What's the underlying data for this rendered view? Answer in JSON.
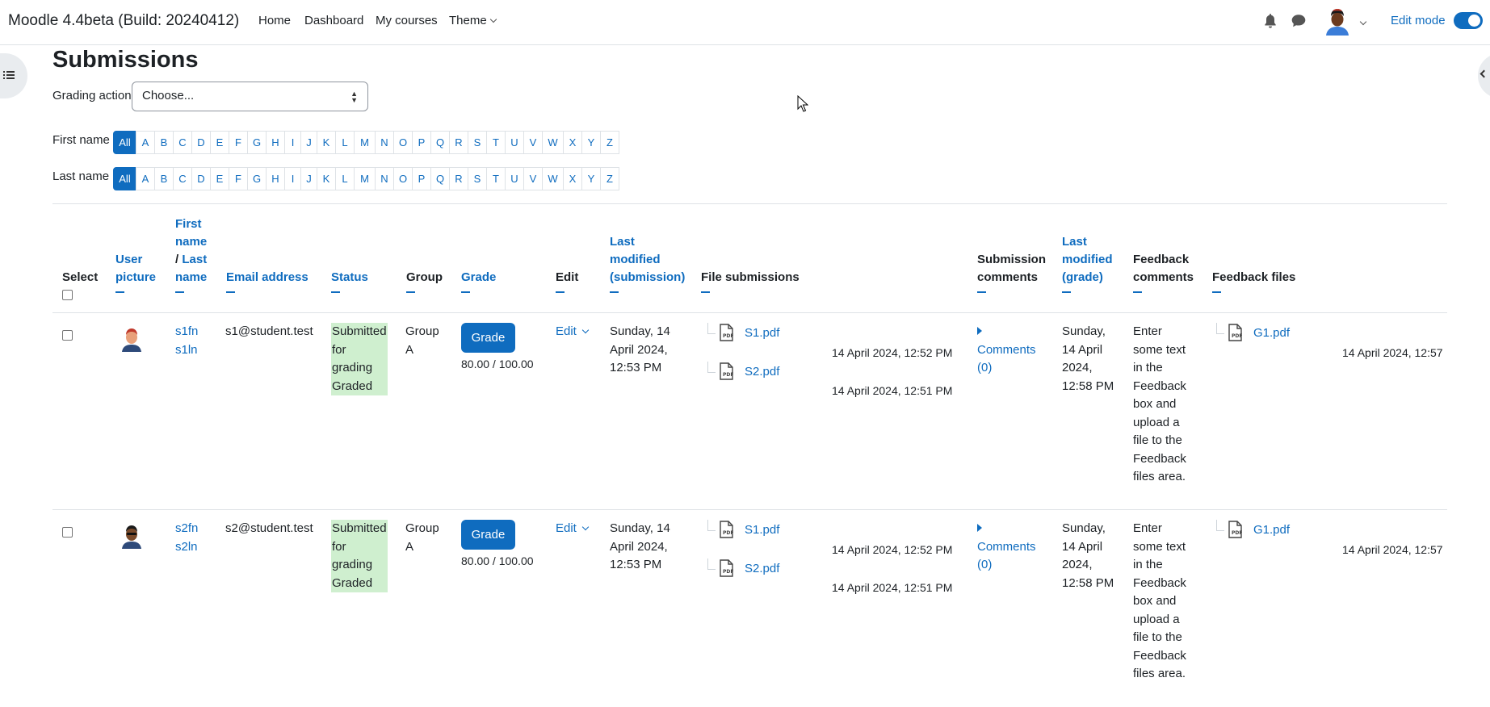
{
  "site": {
    "name": "Moodle 4.4beta (Build: 20240412)",
    "nav": [
      "Home",
      "Dashboard",
      "My courses",
      "Theme"
    ],
    "edit_mode_label": "Edit mode",
    "edit_mode_on": true
  },
  "page": {
    "title": "Submissions",
    "grading_action_label": "Grading action",
    "grading_action_value": "Choose..."
  },
  "initials": {
    "first_name_label": "First name",
    "last_name_label": "Last name",
    "letters": [
      "All",
      "A",
      "B",
      "C",
      "D",
      "E",
      "F",
      "G",
      "H",
      "I",
      "J",
      "K",
      "L",
      "M",
      "N",
      "O",
      "P",
      "Q",
      "R",
      "S",
      "T",
      "U",
      "V",
      "W",
      "X",
      "Y",
      "Z"
    ],
    "selected_first": "All",
    "selected_last": "All"
  },
  "table": {
    "headers": {
      "select": "Select",
      "user_picture": [
        "User",
        "picture"
      ],
      "name": [
        "First",
        "name",
        "/ ",
        "Last",
        "name"
      ],
      "email": "Email address",
      "status": "Status",
      "group": "Group",
      "grade": "Grade",
      "edit": "Edit",
      "last_modified_submission": [
        "Last",
        "modified",
        "(submission)"
      ],
      "file_submissions": "File submissions",
      "submission_comments": [
        "Submission",
        "comments"
      ],
      "last_modified_grade": [
        "Last",
        "modified",
        "(grade)"
      ],
      "feedback_comments": [
        "Feedback",
        "comments"
      ],
      "feedback_files": "Feedback files"
    },
    "rows": [
      {
        "first_name": "s1fn",
        "last_name": "s1ln",
        "email": "s1@student.test",
        "status": [
          "Submitted",
          "for",
          "grading",
          "Graded"
        ],
        "group": [
          "Group",
          "A"
        ],
        "grade_button": "Grade",
        "grade_value": "80.00 / 100.00",
        "edit": "Edit",
        "last_modified_submission": [
          "Sunday, 14",
          "April 2024,",
          "12:53 PM"
        ],
        "files": [
          {
            "name": "S1.pdf",
            "time": "14 April 2024, 12:52 PM"
          },
          {
            "name": "S2.pdf",
            "time": "14 April 2024, 12:51 PM"
          }
        ],
        "comments_label": [
          "Comments",
          "(0)"
        ],
        "last_modified_grade": [
          "Sunday,",
          "14 April",
          "2024,",
          "12:58 PM"
        ],
        "feedback_comments": [
          "Enter",
          "some text",
          "in the",
          "Feedback",
          "box and",
          "upload a",
          "file to the",
          "Feedback",
          "files area."
        ],
        "feedback_file": {
          "name": "G1.pdf",
          "time": "14 April 2024, 12:57"
        },
        "avatar_color": "#e8a07a"
      },
      {
        "first_name": "s2fn",
        "last_name": "s2ln",
        "email": "s2@student.test",
        "status": [
          "Submitted",
          "for",
          "grading",
          "Graded"
        ],
        "group": [
          "Group",
          "A"
        ],
        "grade_button": "Grade",
        "grade_value": "80.00 / 100.00",
        "edit": "Edit",
        "last_modified_submission": [
          "Sunday, 14",
          "April 2024,",
          "12:53 PM"
        ],
        "files": [
          {
            "name": "S1.pdf",
            "time": "14 April 2024, 12:52 PM"
          },
          {
            "name": "S2.pdf",
            "time": "14 April 2024, 12:51 PM"
          }
        ],
        "comments_label": [
          "Comments",
          "(0)"
        ],
        "last_modified_grade": [
          "Sunday,",
          "14 April",
          "2024,",
          "12:58 PM"
        ],
        "feedback_comments": [
          "Enter",
          "some text",
          "in the",
          "Feedback",
          "box and",
          "upload a",
          "file to the",
          "Feedback",
          "files area."
        ],
        "feedback_file": {
          "name": "G1.pdf",
          "time": "14 April 2024, 12:57"
        },
        "avatar_color": "#7a4a2a"
      }
    ]
  },
  "colors": {
    "link": "#0f6cbf",
    "status_bg": "#cfefcf",
    "text": "#1d2125"
  }
}
